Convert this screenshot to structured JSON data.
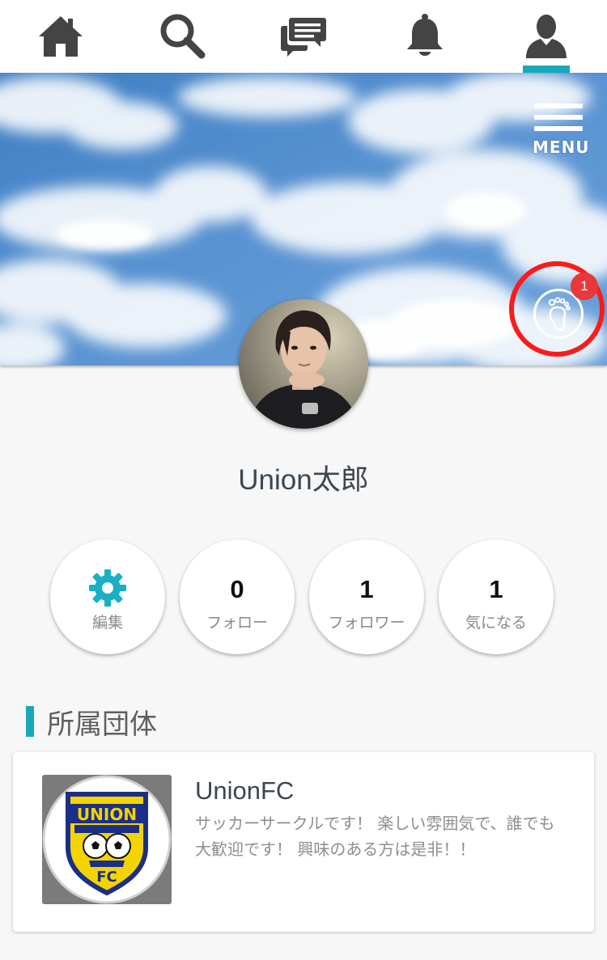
{
  "nav": {
    "items": [
      {
        "icon": "home-icon",
        "active": false
      },
      {
        "icon": "search-icon",
        "active": false
      },
      {
        "icon": "chat-icon",
        "active": false
      },
      {
        "icon": "bell-icon",
        "active": false
      },
      {
        "icon": "person-icon",
        "active": true
      }
    ],
    "accent_color": "#18a8b9"
  },
  "cover": {
    "menu_label": "MENU",
    "footprint_badge": "1",
    "highlight_color": "#ff1a1a"
  },
  "profile": {
    "name": "Union太郎"
  },
  "stats": {
    "edit_label": "編集",
    "follow_count": "0",
    "follow_label": "フォロー",
    "follower_count": "1",
    "follower_label": "フォロワー",
    "interest_count": "1",
    "interest_label": "気になる"
  },
  "groups": {
    "section_title": "所属団体",
    "items": [
      {
        "name": "UnionFC",
        "description": "サッカーサークルです！ 楽しい雰囲気で、誰でも大歓迎です！ 興味のある方は是非！！",
        "logo_text_top": "UNION",
        "logo_text_bottom": "FC"
      }
    ]
  }
}
